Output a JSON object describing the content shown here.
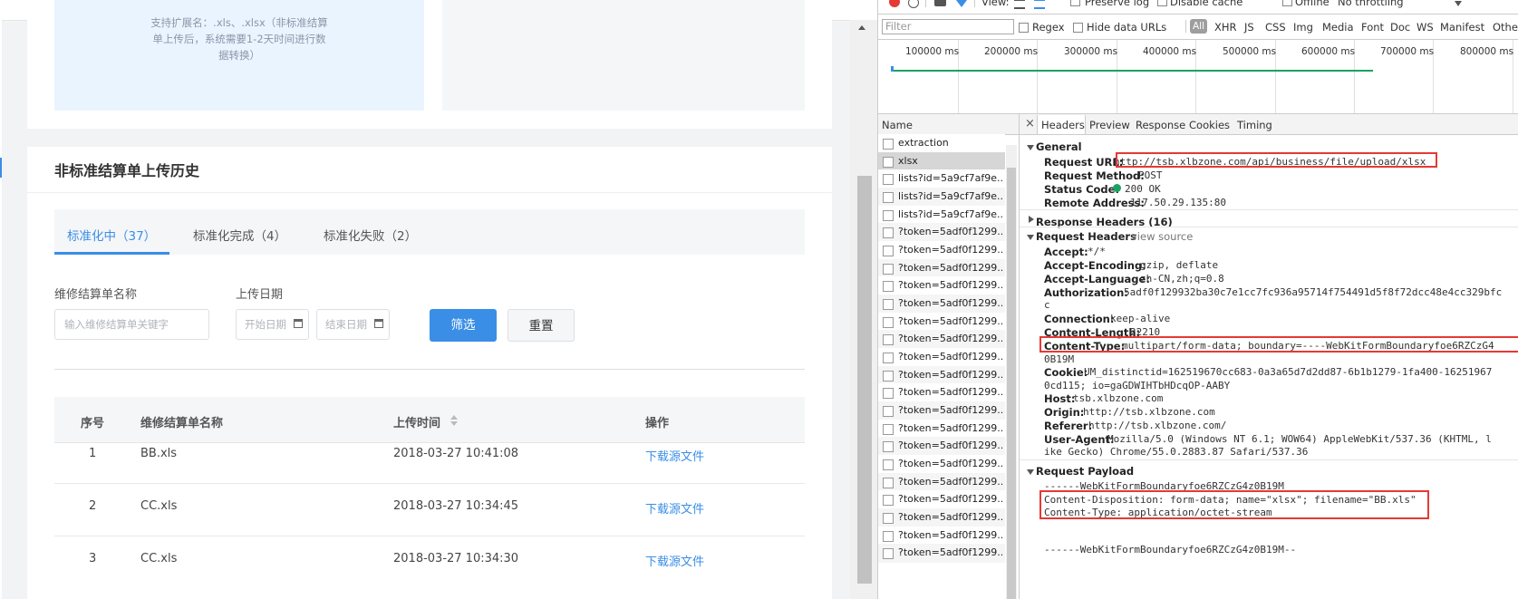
{
  "app": {
    "upload_hint_lines": [
      "支持扩展名：.xls、.xlsx（非标准结算",
      "单上传后，系统需要1-2天时间进行数",
      "据转换）"
    ],
    "history_title": "非标准结算单上传历史",
    "tabs": [
      {
        "label": "标准化中（37）",
        "active": true
      },
      {
        "label": "标准化完成（4）",
        "active": false
      },
      {
        "label": "标准化失败（2）",
        "active": false
      }
    ],
    "form": {
      "name_label": "维修结算单名称",
      "name_placeholder": "输入维修结算单关键字",
      "date_label": "上传日期",
      "start_placeholder": "开始日期",
      "end_placeholder": "结束日期",
      "filter_button": "筛选",
      "reset_button": "重置"
    },
    "table": {
      "headers": [
        "序号",
        "维修结算单名称",
        "上传时间",
        "操作"
      ],
      "rows": [
        {
          "index": "1",
          "name": "BB.xls",
          "time": "2018-03-27 10:41:08",
          "action": "下载源文件"
        },
        {
          "index": "2",
          "name": "CC.xls",
          "time": "2018-03-27 10:34:45",
          "action": "下载源文件"
        },
        {
          "index": "3",
          "name": "CC.xls",
          "time": "2018-03-27 10:34:30",
          "action": "下载源文件"
        }
      ]
    }
  },
  "devtools": {
    "toolbar": {
      "view_label": "View:",
      "preserve_log": "Preserve log",
      "disable_cache": "Disable cache",
      "offline": "Offline",
      "throttling": "No throttling"
    },
    "filter_bar": {
      "filter_placeholder": "Filter",
      "regex": "Regex",
      "hide_data_urls": "Hide data URLs",
      "types": [
        "All",
        "XHR",
        "JS",
        "CSS",
        "Img",
        "Media",
        "Font",
        "Doc",
        "WS",
        "Manifest",
        "Other"
      ]
    },
    "timeline_ticks": [
      "100000 ms",
      "200000 ms",
      "300000 ms",
      "400000 ms",
      "500000 ms",
      "600000 ms",
      "700000 ms",
      "800000 ms"
    ],
    "name_header": "Name",
    "requests": [
      "extraction",
      "xlsx",
      "lists?id=5a9cf7af9e...",
      "lists?id=5a9cf7af9e...",
      "lists?id=5a9cf7af9e...",
      "?token=5adf0f1299...",
      "?token=5adf0f1299...",
      "?token=5adf0f1299...",
      "?token=5adf0f1299...",
      "?token=5adf0f1299...",
      "?token=5adf0f1299...",
      "?token=5adf0f1299...",
      "?token=5adf0f1299...",
      "?token=5adf0f1299...",
      "?token=5adf0f1299...",
      "?token=5adf0f1299...",
      "?token=5adf0f1299...",
      "?token=5adf0f1299...",
      "?token=5adf0f1299...",
      "?token=5adf0f1299...",
      "?token=5adf0f1299...",
      "?token=5adf0f1299...",
      "?token=5adf0f1299...",
      "?token=5adf0f1299..."
    ],
    "detail_tabs": [
      "Headers",
      "Preview",
      "Response",
      "Cookies",
      "Timing"
    ],
    "general": {
      "title": "General",
      "request_url_key": "Request URL:",
      "request_url": "http://tsb.xlbzone.com/api/business/file/upload/xlsx",
      "method_key": "Request Method:",
      "method": "POST",
      "status_key": "Status Code:",
      "status": "200 OK",
      "remote_key": "Remote Address:",
      "remote": "117.50.29.135:80"
    },
    "response_headers_title": "Response Headers (16)",
    "request_headers": {
      "title": "Request Headers",
      "view_source": "view source",
      "accept_key": "Accept:",
      "accept": "*/*",
      "encoding_key": "Accept-Encoding:",
      "encoding": "gzip, deflate",
      "language_key": "Accept-Language:",
      "language": "zh-CN,zh;q=0.8",
      "auth_key": "Authorization:",
      "auth": "5adf0f129932ba30c7e1cc7fc936a95714f754491d5f8f72dcc48e4cc329bfc",
      "auth_cont": "c",
      "connection_key": "Connection:",
      "connection": "keep-alive",
      "length_key": "Content-Length:",
      "length": "22210",
      "ctype_key": "Content-Type:",
      "ctype": "multipart/form-data; boundary=----WebKitFormBoundaryfoe6RZCzG4",
      "ctype_cont": "0B19M",
      "cookie_key": "Cookie:",
      "cookie": "UM_distinctid=162519670cc683-0a3a65d7d2dd87-6b1b1279-1fa400-16251967",
      "cookie_cont": "0cd115; io=gaGDWIHTbHDcqOP-AABY",
      "host_key": "Host:",
      "host": "tsb.xlbzone.com",
      "origin_key": "Origin:",
      "origin": "http://tsb.xlbzone.com",
      "referer_key": "Referer:",
      "referer": "http://tsb.xlbzone.com/",
      "ua_key": "User-Agent:",
      "ua": "Mozilla/5.0 (Windows NT 6.1; WOW64) AppleWebKit/537.36 (KHTML, l",
      "ua_cont": "ike Gecko) Chrome/55.0.2883.87 Safari/537.36"
    },
    "payload": {
      "title": "Request Payload",
      "boundary": "------WebKitFormBoundaryfoe6RZCzG4z0B19M",
      "disposition": "Content-Disposition: form-data; name=\"xlsx\"; filename=\"BB.xls\"",
      "content_type": "Content-Type: application/octet-stream",
      "boundary_end": "------WebKitFormBoundaryfoe6RZCzG4z0B19M--"
    },
    "colors": {
      "accent": "#3a8ee6",
      "highlight": "#e53935",
      "status_ok": "#1aa260"
    }
  }
}
